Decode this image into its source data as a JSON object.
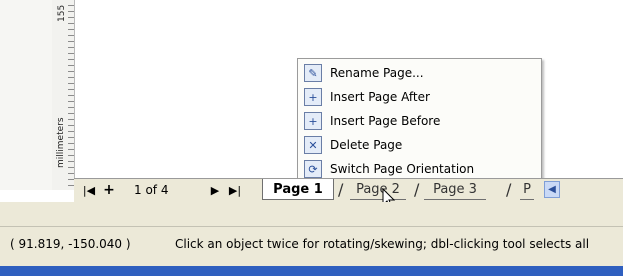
{
  "ruler": {
    "mark": "155",
    "unit": "millimeters"
  },
  "context_menu": {
    "items": [
      {
        "label": "Rename Page...",
        "icon": "rename-page-icon",
        "glyph": "✎"
      },
      {
        "label": "Insert Page After",
        "icon": "insert-page-after-icon",
        "glyph": "+"
      },
      {
        "label": "Insert Page Before",
        "icon": "insert-page-before-icon",
        "glyph": "+"
      },
      {
        "label": "Delete Page",
        "icon": "delete-page-icon",
        "glyph": "✕"
      },
      {
        "label": "Switch Page Orientation",
        "icon": "switch-orientation-icon",
        "glyph": "⟳"
      }
    ]
  },
  "page_nav": {
    "first_symbol": "|◀",
    "add_symbol": "+",
    "count": "1 of 4",
    "next_symbol": "▶",
    "last_symbol": "▶|",
    "tabs": [
      "Page 1",
      "Page 2",
      "Page 3",
      "P"
    ],
    "scroll_symbol": "◀"
  },
  "status_bar": {
    "coordinates": "( 91.819, -150.040 )",
    "hint": "Click an object twice for rotating/skewing; dbl-clicking tool selects all"
  }
}
